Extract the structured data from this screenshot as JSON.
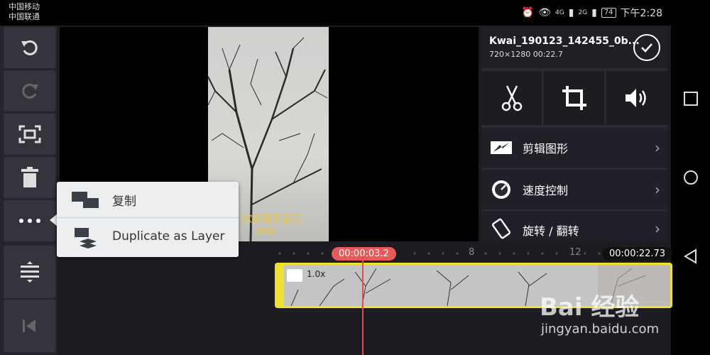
{
  "status": {
    "carrier1": "中国移动",
    "carrier2": "中国联通",
    "signal1": "4G",
    "signal2": "2G",
    "battery": "74",
    "time": "下午2:28"
  },
  "toolbar": {
    "items": [
      "undo-icon",
      "redo-icon",
      "fullscreen-icon",
      "trash-icon",
      "more-icon",
      "align-icon",
      "skip-start-icon"
    ]
  },
  "preview": {
    "caption_line1": "子  欢迎来到百度",
    "caption_line2": "经验"
  },
  "clip": {
    "title": "Kwai_190123_142455_0b...",
    "meta": "720×1280  00:22.7"
  },
  "actions": [
    "scissors-icon",
    "crop-icon",
    "volume-icon"
  ],
  "menu": [
    {
      "label": "剪辑图形"
    },
    {
      "label": "速度控制"
    },
    {
      "label": "旋转 / 翻转"
    }
  ],
  "popup": {
    "item1": "复制",
    "item2": "Duplicate as Layer"
  },
  "timeline": {
    "current": "00:00:03.2",
    "total": "00:00:22.73",
    "tick8": "8",
    "tick12": "12",
    "speed": "1.0x"
  },
  "watermark": {
    "brand": "Bai 经验",
    "url": "jingyan.baidu.com"
  }
}
